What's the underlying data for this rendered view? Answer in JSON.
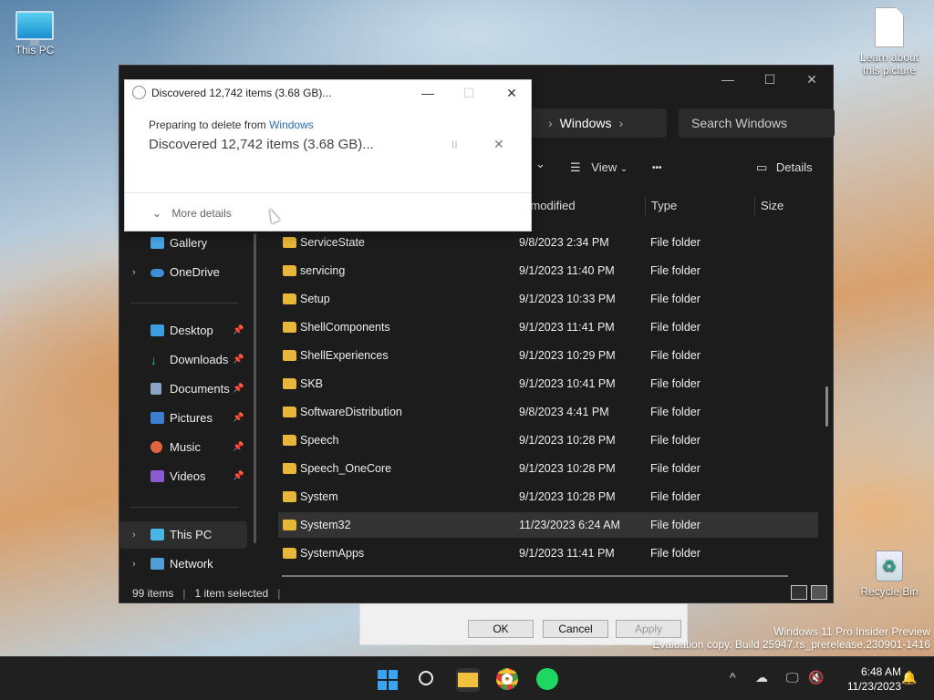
{
  "desktop": {
    "this_pc": "This PC",
    "learn": "Learn about this picture",
    "recycle": "Recycle Bin"
  },
  "explorer": {
    "window_controls": [
      "—",
      "☐",
      "✕"
    ],
    "address": {
      "chev_left": "›",
      "current": "Windows",
      "chev_right": "›"
    },
    "search_placeholder": "Search Windows",
    "toolbar": {
      "sort_chevron": "⌄",
      "view": "View",
      "more": "•••",
      "details": "Details"
    },
    "sidebar": [
      {
        "label": "Gallery",
        "pinned": false,
        "chevron": false
      },
      {
        "label": "OneDrive",
        "pinned": false,
        "chevron": true
      },
      {
        "label": "Desktop",
        "pinned": true,
        "chevron": false
      },
      {
        "label": "Downloads",
        "pinned": true,
        "chevron": false
      },
      {
        "label": "Documents",
        "pinned": true,
        "chevron": false
      },
      {
        "label": "Pictures",
        "pinned": true,
        "chevron": false
      },
      {
        "label": "Music",
        "pinned": true,
        "chevron": false
      },
      {
        "label": "Videos",
        "pinned": true,
        "chevron": false
      },
      {
        "label": "This PC",
        "pinned": false,
        "chevron": true
      },
      {
        "label": "Network",
        "pinned": false,
        "chevron": true
      }
    ],
    "columns": {
      "date": "te modified",
      "type": "Type",
      "size": "Size"
    },
    "rows": [
      {
        "name": "ServiceState",
        "date": "9/8/2023 2:34 PM",
        "type": "File folder"
      },
      {
        "name": "servicing",
        "date": "9/1/2023 11:40 PM",
        "type": "File folder"
      },
      {
        "name": "Setup",
        "date": "9/1/2023 10:33 PM",
        "type": "File folder"
      },
      {
        "name": "ShellComponents",
        "date": "9/1/2023 11:41 PM",
        "type": "File folder"
      },
      {
        "name": "ShellExperiences",
        "date": "9/1/2023 10:29 PM",
        "type": "File folder"
      },
      {
        "name": "SKB",
        "date": "9/1/2023 10:41 PM",
        "type": "File folder"
      },
      {
        "name": "SoftwareDistribution",
        "date": "9/8/2023 4:41 PM",
        "type": "File folder"
      },
      {
        "name": "Speech",
        "date": "9/1/2023 10:28 PM",
        "type": "File folder"
      },
      {
        "name": "Speech_OneCore",
        "date": "9/1/2023 10:28 PM",
        "type": "File folder"
      },
      {
        "name": "System",
        "date": "9/1/2023 10:28 PM",
        "type": "File folder"
      },
      {
        "name": "System32",
        "date": "11/23/2023 6:24 AM",
        "type": "File folder"
      },
      {
        "name": "SystemApps",
        "date": "9/1/2023 11:41 PM",
        "type": "File folder"
      }
    ],
    "selected_row": "System32",
    "status": {
      "count": "99 items",
      "selected": "1 item selected"
    }
  },
  "delete_dialog": {
    "title": "Discovered 12,742 items (3.68 GB)...",
    "controls": [
      "—",
      "☐",
      "✕"
    ],
    "preparing": "Preparing to delete from",
    "location": "Windows",
    "discovered": "Discovered 12,742 items (3.68 GB)...",
    "pause": "II",
    "cancel": "✕",
    "more_details": "More details",
    "more_chevron": "⌄"
  },
  "properties_dialog": {
    "ok": "OK",
    "cancel": "Cancel",
    "apply": "Apply"
  },
  "watermark": {
    "line1": "Windows 11 Pro Insider Preview",
    "line2": "Evaluation copy. Build 25947.rs_prerelease.230901-1416"
  },
  "taskbar": {
    "time": "6:48 AM",
    "date": "11/23/2023",
    "tray_up": "^"
  }
}
